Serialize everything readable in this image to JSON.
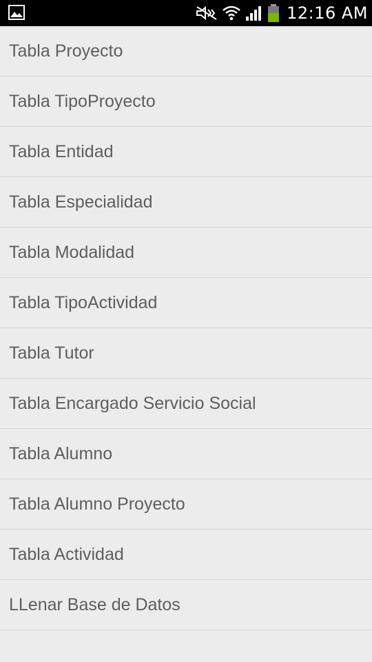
{
  "status_bar": {
    "left_icon": "image-icon",
    "icons": [
      "mute-icon",
      "wifi-icon",
      "signal-icon",
      "battery-icon"
    ],
    "time": "12:16 AM",
    "battery_color": "#7ab800"
  },
  "menu": {
    "items": [
      {
        "label": "Tabla Proyecto"
      },
      {
        "label": "Tabla TipoProyecto"
      },
      {
        "label": "Tabla Entidad"
      },
      {
        "label": "Tabla Especialidad"
      },
      {
        "label": "Tabla Modalidad"
      },
      {
        "label": "Tabla TipoActividad"
      },
      {
        "label": "Tabla Tutor"
      },
      {
        "label": "Tabla Encargado Servicio Social"
      },
      {
        "label": "Tabla Alumno"
      },
      {
        "label": "Tabla Alumno Proyecto"
      },
      {
        "label": "Tabla Actividad"
      },
      {
        "label": "LLenar Base de Datos"
      }
    ]
  }
}
